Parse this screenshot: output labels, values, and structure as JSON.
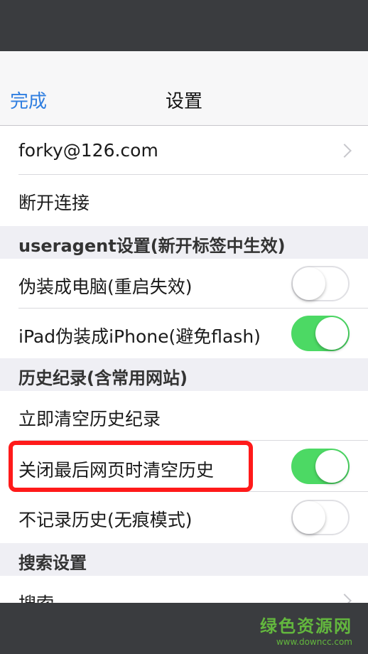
{
  "navbar": {
    "done_label": "完成",
    "title": "设置"
  },
  "account": {
    "email": "forky@126.com",
    "disconnect": "断开连接"
  },
  "sections": {
    "useragent": "useragent设置(新开标签中生效)",
    "history": "历史纪录(含常用网站)",
    "search": "搜索设置"
  },
  "settings": {
    "fake_pc": {
      "label": "伪装成电脑(重启失效)",
      "enabled": false
    },
    "ipad_iphone": {
      "label": "iPad伪装成iPhone(避免flash)",
      "enabled": true
    },
    "clear_now": {
      "label": "立即清空历史纪录"
    },
    "clear_on_close": {
      "label": "关闭最后网页时清空历史",
      "enabled": true
    },
    "incognito": {
      "label": "不记录历史(无痕模式)",
      "enabled": false
    },
    "search": {
      "label": "搜索"
    }
  },
  "watermark": {
    "name": "绿色资源网",
    "url": "www.downcc.com"
  },
  "colors": {
    "accent": "#2f7ee0",
    "toggle_on": "#4cd964",
    "highlight": "#ff1a1a"
  }
}
